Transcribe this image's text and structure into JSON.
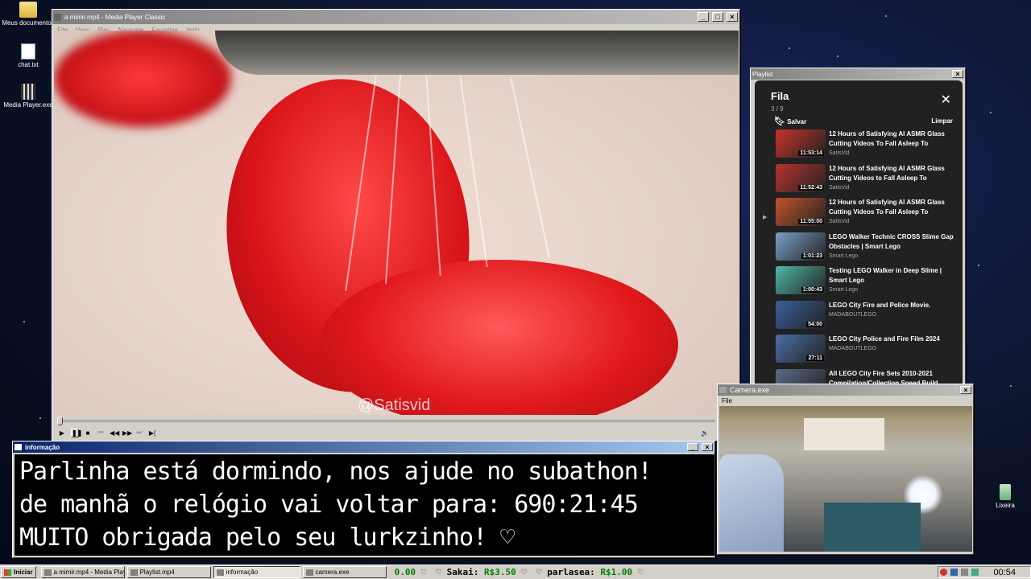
{
  "desktop": {
    "icons": [
      {
        "label": "Meus documentos"
      },
      {
        "label": "chat.txt"
      },
      {
        "label": "Media Player.exe"
      },
      {
        "label": "Lixeira"
      }
    ]
  },
  "media_player": {
    "title": "a mimir.mp4 - Media Player Classic",
    "menu": [
      "File",
      "View",
      "Play",
      "Navigate",
      "Favorites",
      "Help"
    ],
    "watermark": "@Satisvid"
  },
  "playlist_window": {
    "title": "Playlist",
    "header": "Fila",
    "count": "3 / 9",
    "save_label": "Salvar",
    "clear_label": "Limpar",
    "close_glyph": "✕",
    "items": [
      {
        "title": "12 Hours of Satisfying AI ASMR Glass Cutting Videos To Fall Asleep To",
        "channel": "SatisVid",
        "duration": "11:53:14",
        "thumb_color": "#c8332b",
        "playing": false
      },
      {
        "title": "12 Hours of Satisfying AI ASMR Glass Cutting Videos to Fall Asleep To",
        "channel": "SatisVid",
        "duration": "11:52:43",
        "thumb_color": "#b8332f",
        "playing": false
      },
      {
        "title": "12 Hours of Satisfying AI ASMR Glass Cutting Videos To Fall Asleep To",
        "channel": "SatisVid",
        "duration": "11:55:00",
        "thumb_color": "#c2542a",
        "playing": true
      },
      {
        "title": "LEGO Walker Technic CROSS Slime Gap Obstacles | Smart Lego",
        "channel": "Smart Lego",
        "duration": "1:01:23",
        "thumb_color": "#7aa0c8",
        "playing": false
      },
      {
        "title": "Testing LEGO Walker in Deep Slime | Smart Lego",
        "channel": "Smart Lego",
        "duration": "1:00:43",
        "thumb_color": "#4fb8a6",
        "playing": false
      },
      {
        "title": "LEGO City Fire and Police Movie.",
        "channel": "MADABOUTLEGO",
        "duration": "54:00",
        "thumb_color": "#3a5f9c",
        "playing": false
      },
      {
        "title": "LEGO City Police and Fire Film 2024",
        "channel": "MADABOUTLEGO",
        "duration": "27:11",
        "thumb_color": "#4a6fa8",
        "playing": false
      },
      {
        "title": "All LEGO City Fire Sets 2010-2021 Compilation/Collection Speed Build",
        "channel": "",
        "duration": "",
        "thumb_color": "#5a6a88",
        "playing": false
      }
    ]
  },
  "info_window": {
    "title": "informação",
    "lines": [
      "Parlinha está dormindo, nos ajude no subathon!",
      "de manhã o relógio vai voltar para:  690:21:45",
      "MUITO obrigada pelo seu lurkzinho! ♡"
    ]
  },
  "camera_window": {
    "title": "Camera.exe",
    "menu": "File"
  },
  "taskbar": {
    "start_label": "Iniciar",
    "tasks": [
      {
        "label": "a mimir.mp4 - Media Playe...",
        "active": false
      },
      {
        "label": "Playlist.mp4",
        "active": false
      },
      {
        "label": "informação",
        "active": true
      },
      {
        "label": "camera.exe",
        "active": false
      }
    ],
    "ticker": {
      "lead": "0.00",
      "heart": "♡",
      "entries": [
        {
          "name": "Sakai:",
          "amount": "R$3.50"
        },
        {
          "name": "parlasea:",
          "amount": "R$1.00"
        }
      ]
    },
    "clock": "00:54"
  },
  "colors": {
    "titlebar_active": "#0a246a",
    "window_face": "#d4d0c8",
    "youtube_bg": "#212121",
    "ticker_money": "#008000"
  }
}
